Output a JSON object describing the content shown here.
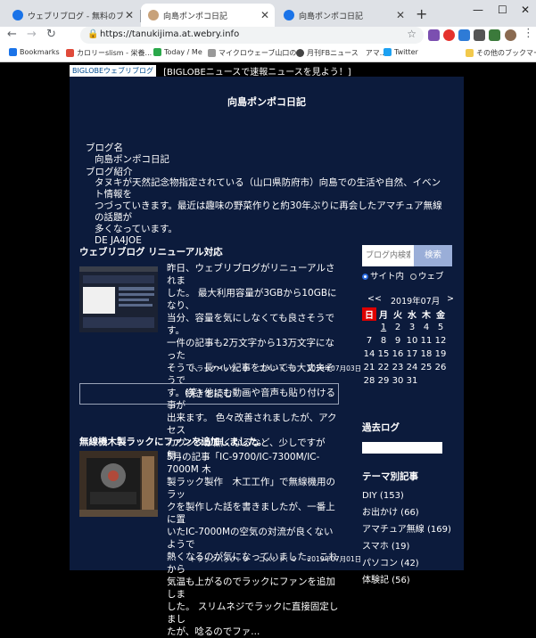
{
  "browser": {
    "tabs": [
      {
        "title": "ウェブリブログ - 無料のブログ(blog)サ",
        "active": false
      },
      {
        "title": "向島ポンポコ日記",
        "active": true
      },
      {
        "title": "向島ポンポコ日記",
        "active": false
      }
    ],
    "url": "https://tanukijima.at.webry.info",
    "bookmarks": [
      "Bookmarks",
      "カロリーslism - 栄養...",
      "Today / Me",
      "マイクロウェーブ山口の...",
      "月刊FBニュース　アマ...",
      "Twitter",
      "その他のブックマーク"
    ],
    "accent": "#1a73e8"
  },
  "top": {
    "logo": "BIGLOBEウェブリブログ",
    "news": "[BIGLOBEニュースで速報ニュースを見よう！]"
  },
  "blog": {
    "title": "向島ポンポコ日記",
    "name_label": "ブログ名",
    "name_value": "向島ポンポコ日記",
    "intro_label": "ブログ紹介",
    "intro_lines": [
      "タヌキが天然記念物指定されている（山口県防府市）向島での生活や自然、イベント情報を",
      "つづっていきます。最近は趣味の野菜作りと約30年ぶりに再会したアマチュア無線の話題が",
      "多くなっています。",
      "DE JA4JOE"
    ]
  },
  "entries": [
    {
      "title": "ウェブリブログ リニューアル対応",
      "lines": [
        "昨日、ウェブリブログがリニューアルされま",
        "した。 最大利用容量が3GBから10GBになり、",
        "当分、容量を気にしなくても良さそうです。",
        "一件の記事も2万文字から13万文字になった",
        "そうで、長～い記事をかいても大丈夫そうで",
        "す。(笑) 他にも動画や音声も貼り付ける事が",
        "出来ます。 色々改善されましたが、アクセス",
        "カウンタが無くなるなど、少しですが無..."
      ],
      "trackback": "トラックバック：0",
      "comment": "コメント：0",
      "date": "2019年07月03日",
      "readmore": "続きを読む"
    },
    {
      "title": "無線機木製ラックにファンを追加しました。",
      "lines": [
        "5月の記事「IC-9700/IC-7300M/IC-7000M 木",
        "製ラック製作　木工工作」で無線機用のラッ",
        "クを製作した話を書きましたが、一番上に置",
        "いたIC-7000Mの空気の対流が良くないようで",
        "熱くなるのが気になっていました。 これから",
        "気温も上がるのでラックにファンを追加しま",
        "した。 スリムネジでラックに直接固定しまし",
        "たが、唸るのでファ..."
      ],
      "trackback": "トラックバック：0",
      "comment": "コメント：0",
      "date": "2019年07月01日"
    }
  ],
  "sidebar": {
    "search_placeholder": "ブログ内検索",
    "search_button": "検索",
    "radio_site": "サイト内",
    "radio_web": "ウェブ",
    "calendar": {
      "prev": "<<",
      "month": "2019年07月",
      "next": ">",
      "weekdays": [
        "日",
        "月",
        "火",
        "水",
        "木",
        "金"
      ],
      "weeks": [
        [
          "",
          "1",
          "2",
          "3",
          "4",
          "5"
        ],
        [
          "7",
          "8",
          "9",
          "10",
          "11",
          "12"
        ],
        [
          "14",
          "15",
          "16",
          "17",
          "18",
          "19"
        ],
        [
          "21",
          "22",
          "23",
          "24",
          "25",
          "26"
        ],
        [
          "28",
          "29",
          "30",
          "31",
          "",
          ""
        ]
      ],
      "linked_days": [
        "1"
      ]
    },
    "archive_title": "過去ログ",
    "theme_title": "テーマ別記事",
    "themes": [
      "DIY (153)",
      "お出かけ (66)",
      "アマチュア無線 (169)",
      "スマホ (19)",
      "パソコン (42)",
      "体験記 (56)"
    ]
  }
}
